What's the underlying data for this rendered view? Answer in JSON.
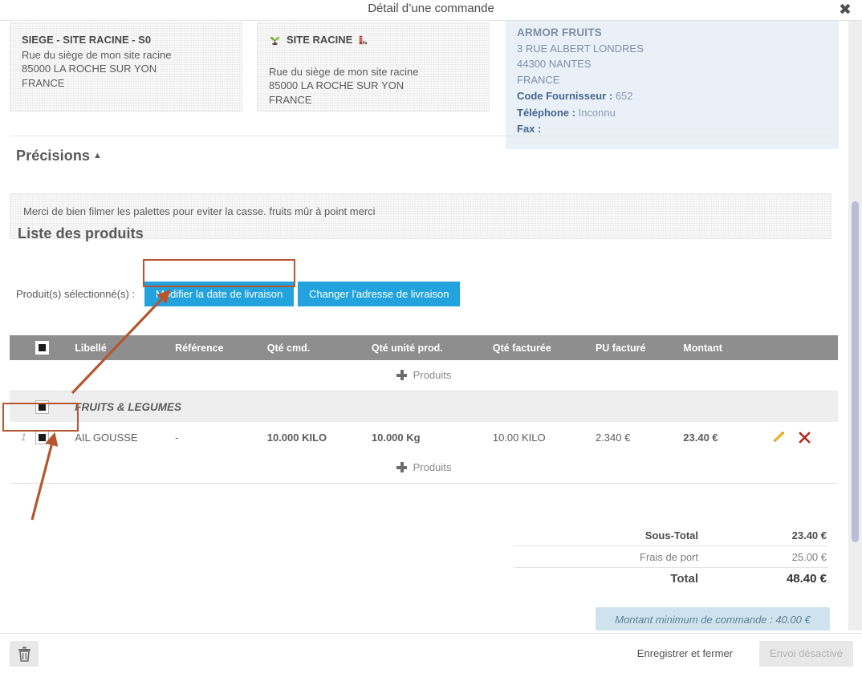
{
  "window": {
    "title": "Détail d’une commande",
    "close_icon": "close-icon"
  },
  "addresses": {
    "siege": {
      "title": "SIEGE - SITE RACINE - S0",
      "line1": "Rue du siège de mon site racine",
      "line2": "85000 LA ROCHE SUR YON",
      "line3": "FRANCE"
    },
    "site": {
      "title": "SITE RACINE",
      "left_icon": "sprout-icon",
      "right_icon": "factory-icon",
      "line1": "Rue du siège de mon site racine",
      "line2": "85000 LA ROCHE SUR YON",
      "line3": "FRANCE"
    },
    "supplier": {
      "name": "ARMOR FRUITS",
      "street": "3 RUE ALBERT LONDRES",
      "city": "44300 NANTES",
      "country": "FRANCE",
      "code_label": "Code Fournisseur :",
      "code_value": "652",
      "phone_label": "Téléphone :",
      "phone_value": "Inconnu",
      "fax_label": "Fax :",
      "fax_value": ""
    }
  },
  "precisions": {
    "heading": "Précisions",
    "caret": "▲",
    "text": "Merci de bien filmer les palettes pour eviter la casse. fruits mûr à point merci"
  },
  "products_section": {
    "heading": "Liste des produits",
    "selected_label": "Produit(s) sélectionné(s) :",
    "btn_change_date": "Modifier la date de livraison",
    "btn_change_address": "Changer l'adresse de livraison",
    "add_product_label": "Produits",
    "columns": [
      "",
      "Libellé",
      "Référence",
      "Qté cmd.",
      "Qté unité prod.",
      "Qté facturée",
      "PU facturé",
      "Montant",
      ""
    ],
    "family_row": {
      "name": "FRUITS & LEGUMES"
    },
    "rows": [
      {
        "index": "1",
        "libelle": "AIL GOUSSE",
        "reference": "-",
        "qte_cmd": "10.000 KILO",
        "qte_unite_prod": "10.000 Kg",
        "qte_facturee": "10.00 KILO",
        "pu_facture": "2.340 €",
        "montant": "23.40 €",
        "edit_icon": "pencil-icon",
        "delete_icon": "x-icon"
      }
    ]
  },
  "totals": {
    "subtotal_label": "Sous-Total",
    "subtotal_value": "23.40 €",
    "shipping_label": "Frais de port",
    "shipping_value": "25.00 €",
    "total_label": "Total",
    "total_value": "48.40 €",
    "minimum_notice": "Montant minimum de commande : 40.00 €"
  },
  "footer": {
    "delete_icon": "trash-icon",
    "save_label": "Enregistrer et fermer",
    "send_label": "Envoi désactivé"
  },
  "colors": {
    "accent_blue": "#23a3dd",
    "header_grey": "#8e8e8e",
    "supplier_bg": "#eaf0f8",
    "annotation": "#b5562f",
    "notice_bg": "#cfe3ee"
  }
}
